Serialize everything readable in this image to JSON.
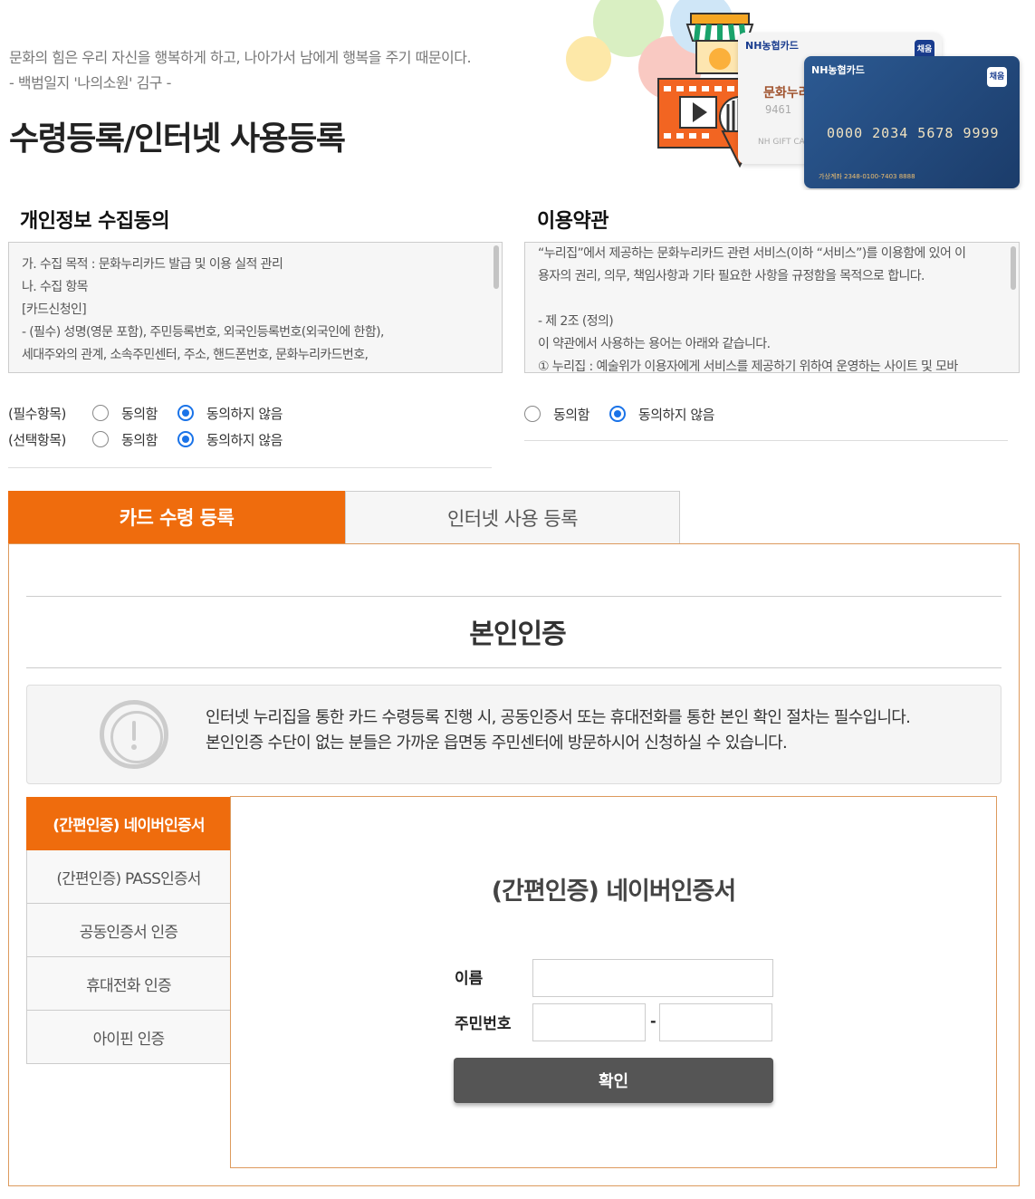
{
  "header": {
    "quote_line1": "문화의 힘은 우리 자신을 행복하게 하고, 나아가서 남에게 행복을 주기 때문이다.",
    "quote_line2": "- 백범일지 '나의소원' 김구 -",
    "page_title": "수령등록/인터넷 사용등록"
  },
  "hero": {
    "card_brand": "NH농협카드",
    "card_badge": "채움",
    "card_number": "0000 2034 5678 9999",
    "card_foot": "가상계좌 2348-0100-7403 8888",
    "card_label": "문화누리",
    "card_small_num": "9461",
    "card_gift": "NH GIFT CA"
  },
  "privacy": {
    "title": "개인정보 수집동의",
    "lines": [
      "가. 수집 목적 : 문화누리카드 발급 및 이용 실적 관리",
      "나. 수집 항목",
      "[카드신청인]",
      "- (필수) 성명(영문 포함), 주민등록번호, 외국인등록번호(외국인에 한함),",
      "세대주와의 관계, 소속주민센터, 주소, 핸드폰번호, 문화누리카드번호,"
    ],
    "required_label": "(필수항목)",
    "optional_label": "(선택항목)",
    "agree": "동의함",
    "disagree": "동의하지 않음"
  },
  "terms": {
    "title": "이용약관",
    "lines": [
      "“누리집”에서 제공하는 문화누리카드 관련 서비스(이하 “서비스”)를 이용함에 있어 이",
      "용자의 권리, 의무, 책임사항과 기타 필요한 사항을 규정함을 목적으로 합니다.",
      "",
      "- 제 2조 (정의)",
      "이 약관에서 사용하는 용어는 아래와 같습니다.",
      "① 누리집 : 예술위가 이용자에게 서비스를 제공하기 위하여 운영하는 사이트 및 모바"
    ],
    "agree": "동의함",
    "disagree": "동의하지 않음"
  },
  "tabs": [
    {
      "label": "카드 수령 등록",
      "active": true
    },
    {
      "label": "인터넷 사용 등록",
      "active": false
    }
  ],
  "verification": {
    "title": "본인인증",
    "notice_line1": "인터넷 누리집을 통한 카드 수령등록 진행 시, 공동인증서 또는 휴대전화를 통한 본인 확인 절차는 필수입니다.",
    "notice_line2": "본인인증 수단이 없는 분들은 가까운 읍면동 주민센터에 방문하시어 신청하실 수 있습니다."
  },
  "auth_methods": [
    {
      "label": "(간편인증) 네이버인증서",
      "active": true
    },
    {
      "label": "(간편인증) PASS인증서",
      "active": false
    },
    {
      "label": "공동인증서 인증",
      "active": false
    },
    {
      "label": "휴대전화 인증",
      "active": false
    },
    {
      "label": "아이핀 인증",
      "active": false
    }
  ],
  "auth_form": {
    "title": "(간편인증) 네이버인증서",
    "name_label": "이름",
    "id_label": "주민번호",
    "dash": "-",
    "confirm": "확인"
  },
  "colors": {
    "accent": "#ef6c0d",
    "border_accent": "#dd9a5d",
    "radio_selected": "#1a73e8",
    "button": "#555555"
  }
}
